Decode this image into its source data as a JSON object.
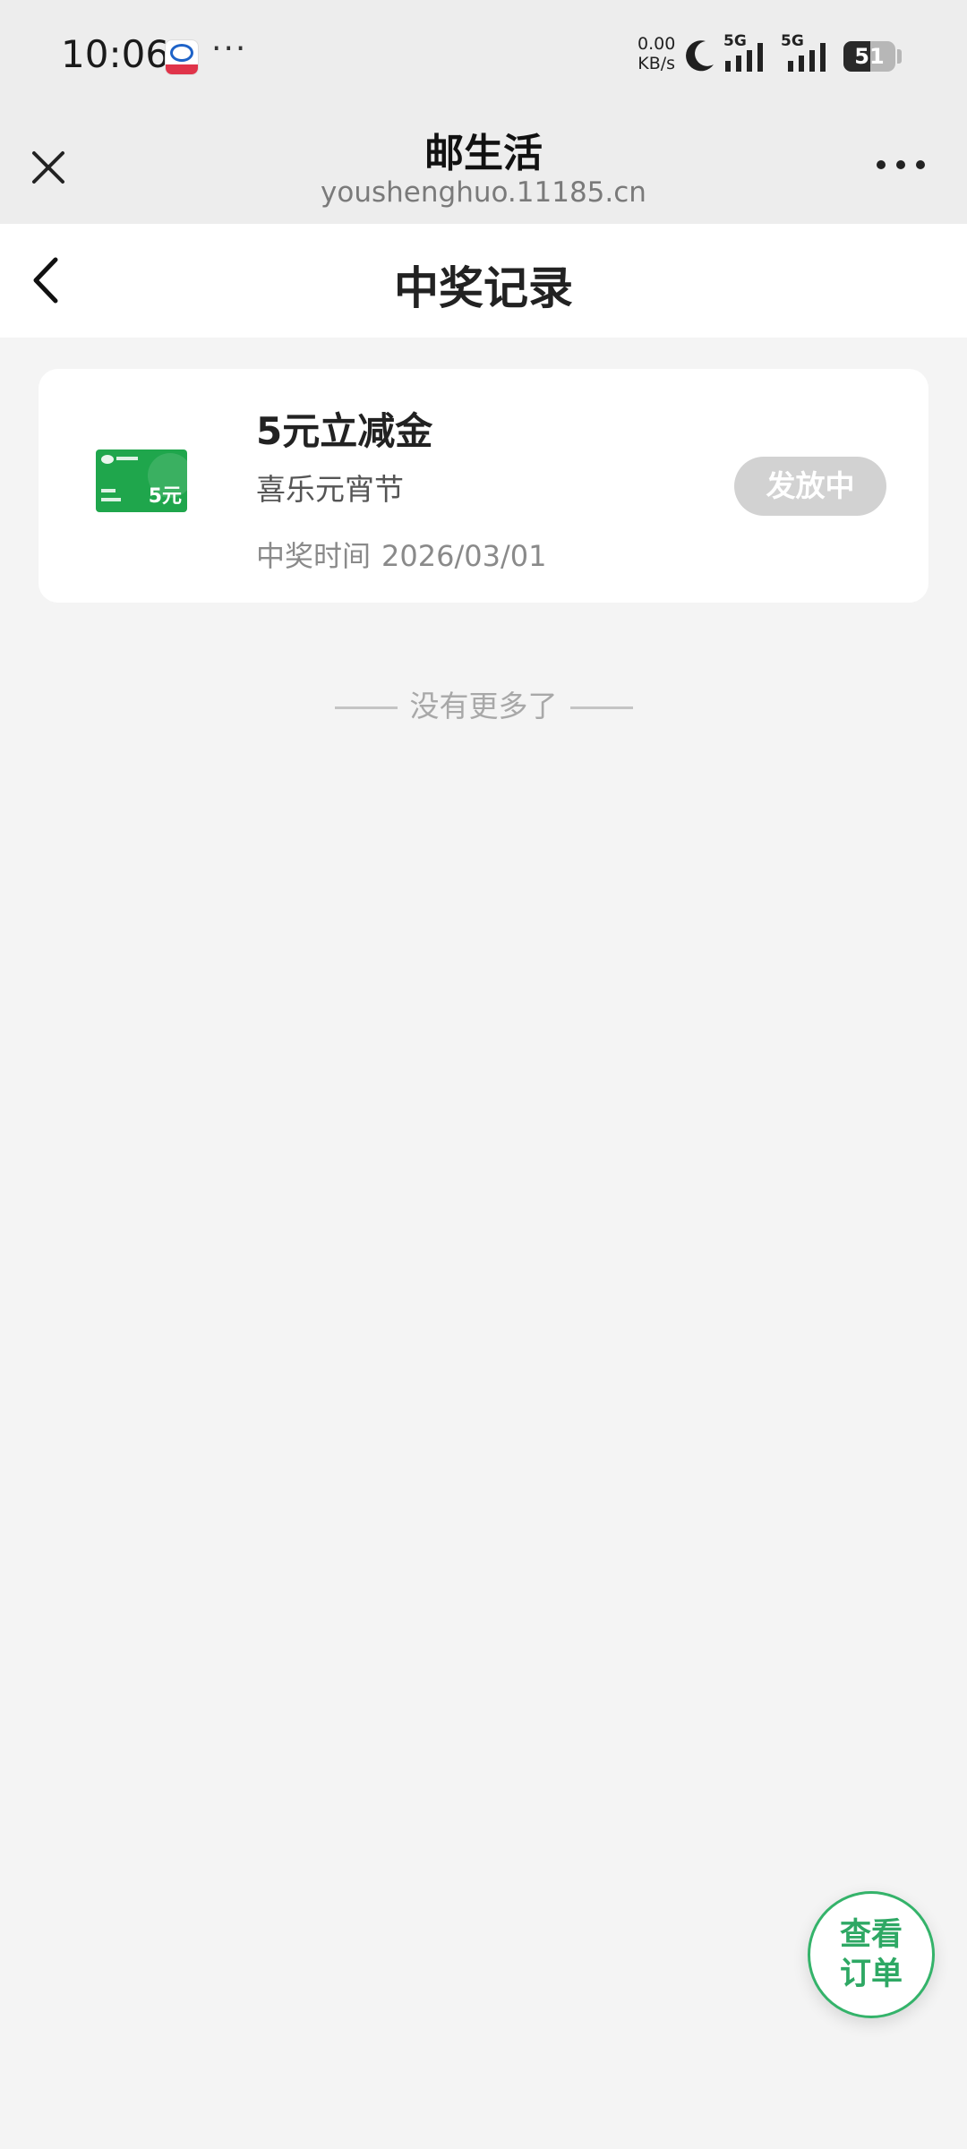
{
  "status_bar": {
    "time": "10:06",
    "more_indicator": "···",
    "net_speed_value": "0.00",
    "net_speed_unit": "KB/s",
    "sim1_label": "5G",
    "sim2_label": "5G",
    "battery_level": "51",
    "battery_fraction": 0.51
  },
  "browser": {
    "title": "邮生活",
    "url": "youshenghuo.11185.cn"
  },
  "page": {
    "title": "中奖记录"
  },
  "records": [
    {
      "prize_name": "5元立减金",
      "thumbnail_amount": "5元",
      "event_name": "喜乐元宵节",
      "time_label": "中奖时间",
      "time_value": "2026/03/01",
      "status": "发放中"
    }
  ],
  "list_end_text": "没有更多了",
  "fab": {
    "line1": "查看",
    "line2": "订单"
  },
  "colors": {
    "accent_green": "#2ea864",
    "pill_gray": "#d2d2d2",
    "page_bg": "#f4f4f4"
  },
  "icons": {
    "close": "close-icon",
    "more": "more-horizontal-icon",
    "back": "chevron-left-icon",
    "moon": "moon-icon",
    "signal": "signal-icon",
    "battery": "battery-icon",
    "thumbnail": "prize-card-thumbnail"
  }
}
